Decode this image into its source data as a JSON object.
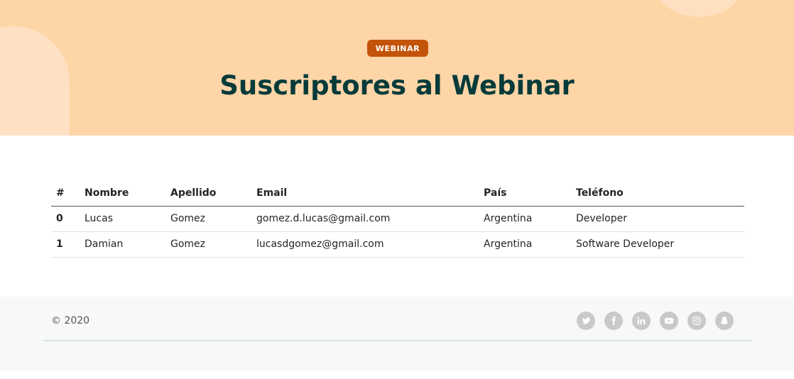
{
  "hero": {
    "badge": "WEBINAR",
    "title": "Suscriptores al Webinar"
  },
  "table": {
    "headers": [
      "#",
      "Nombre",
      "Apellido",
      "Email",
      "País",
      "Teléfono"
    ],
    "rows": [
      {
        "index": "0",
        "nombre": "Lucas",
        "apellido": "Gomez",
        "email": "gomez.d.lucas@gmail.com",
        "pais": "Argentina",
        "telefono": "Developer"
      },
      {
        "index": "1",
        "nombre": "Damian",
        "apellido": "Gomez",
        "email": "lucasdgomez@gmail.com",
        "pais": "Argentina",
        "telefono": "Software Developer"
      }
    ]
  },
  "footer": {
    "copyright": "© 2020",
    "socials": [
      "twitter-icon",
      "facebook-icon",
      "linkedin-icon",
      "youtube-icon",
      "instagram-icon",
      "snapchat-icon"
    ]
  },
  "colors": {
    "hero_bg": "#fed5a7",
    "badge_bg": "#c35308",
    "title": "#073b3a",
    "footer_bg": "#f7f8f8",
    "social_icon_bg": "#c9c9c9"
  }
}
